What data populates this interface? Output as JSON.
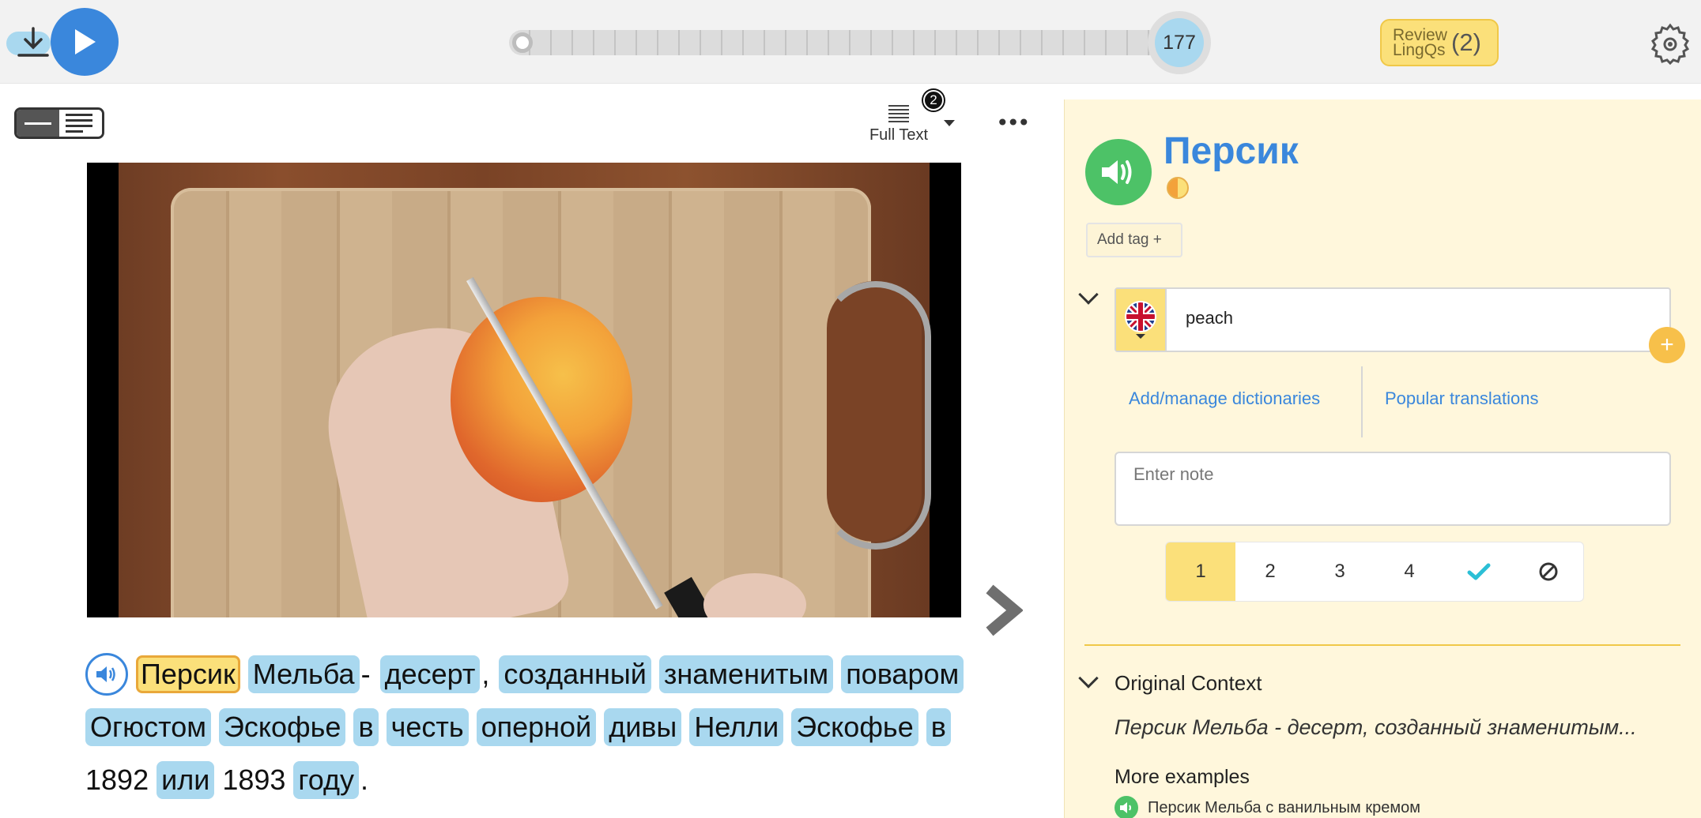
{
  "player": {
    "position_count": "177"
  },
  "review": {
    "label_line1": "Review",
    "label_line2": "LingQs",
    "count": "(2)"
  },
  "toolbar": {
    "fulltext_label": "Full Text",
    "fulltext_badge": "2"
  },
  "reader": {
    "line1": [
      "Персик",
      "Мельба",
      "-",
      "десерт",
      ",",
      "созданный",
      "знаменитым",
      "поваром"
    ],
    "line2": [
      "Огюстом",
      "Эскофье",
      "в",
      "честь",
      "оперной",
      "дивы",
      "Нелли",
      "Эскофье",
      "в"
    ],
    "line3": [
      "1892",
      "или",
      "1893",
      "году",
      "."
    ]
  },
  "panel": {
    "term": "Персик",
    "add_tag": "Add tag +",
    "hint_value": "peach",
    "plus": "+",
    "manage_dictionaries": "Add/manage dictionaries",
    "popular_translations": "Popular translations",
    "note_placeholder": "Enter note",
    "status_levels": [
      "1",
      "2",
      "3",
      "4"
    ],
    "status_selected": "1",
    "original_context_heading": "Original Context",
    "original_context_text": "Персик Мельба - десерт, созданный знаменитым...",
    "more_examples_heading": "More examples",
    "example_1": "Персик Мельба с ванильным кремом"
  },
  "icons": {
    "download": "download-icon",
    "play": "play-icon",
    "settings": "gear-icon",
    "speaker": "speaker-icon",
    "flag": "uk-flag-icon",
    "known": "checkmark-icon",
    "ignore": "ignore-icon",
    "next": "chevron-right-icon"
  },
  "colors": {
    "accent_blue": "#3a87dc",
    "highlight_blue": "#a9d8ef",
    "lingq_yellow": "#fbe07a",
    "panel_bg": "#fff7dc",
    "audio_green": "#4dc267",
    "known_teal": "#2bbfd6"
  }
}
